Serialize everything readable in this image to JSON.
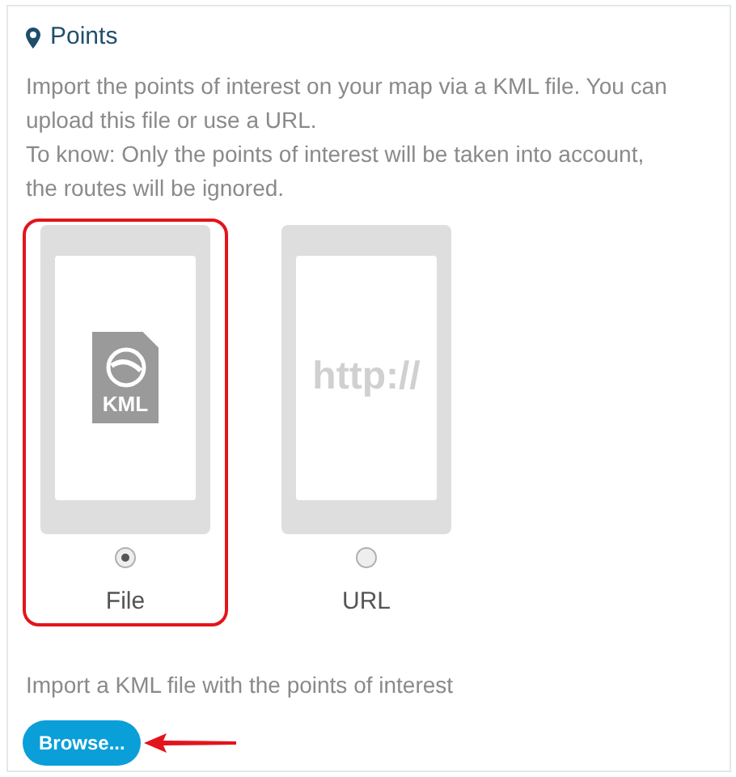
{
  "panel": {
    "title": "Points",
    "description": [
      "Import the points of interest on your map via a KML file. You can upload this file or use a URL.",
      "To know: Only the points of interest will be taken into account, the routes will be ignored."
    ],
    "options": [
      {
        "kind": "file",
        "label": "File",
        "icon_text": "KML",
        "selected": true
      },
      {
        "kind": "url",
        "label": "URL",
        "icon_text": "http://",
        "selected": false
      }
    ],
    "upload_hint": "Import a KML file with the points of interest",
    "browse_button": "Browse..."
  }
}
